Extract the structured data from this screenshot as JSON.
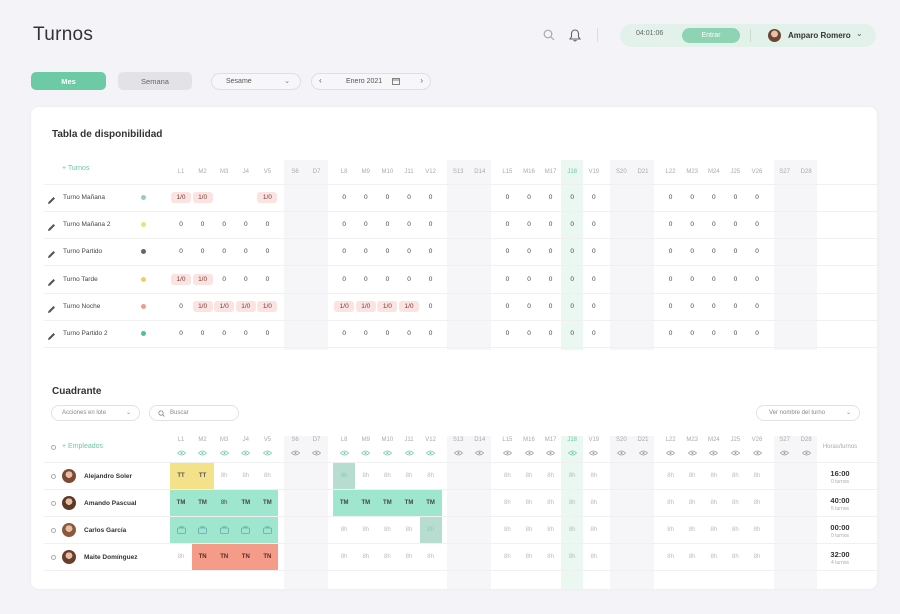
{
  "header": {
    "title": "Turnos",
    "timer": "04:01:06",
    "enter_label": "Entrar",
    "user_name": "Amparo Romero",
    "icons": [
      "search-icon",
      "bell-icon",
      "chevron-down-icon"
    ]
  },
  "toolbar": {
    "view_month": "Mes",
    "view_week": "Semana",
    "company": "Sesame",
    "month": "Enero 2021"
  },
  "availability": {
    "title": "Tabla de disponibilidad",
    "add_label": "+ Turnos",
    "days": [
      "L1",
      "M2",
      "M3",
      "J4",
      "V5",
      "S6",
      "D7",
      "L8",
      "M9",
      "M10",
      "J11",
      "V12",
      "S13",
      "D14",
      "L15",
      "M16",
      "M17",
      "J18",
      "V19",
      "S20",
      "D21",
      "L22",
      "M23",
      "M24",
      "J25",
      "V26",
      "S27",
      "D28"
    ],
    "rows": [
      {
        "name": "Turno Mañana",
        "dot": "#8ed3b4",
        "cells": [
          "1/0",
          "1/0",
          "",
          "",
          "1/0",
          "",
          "",
          "0",
          "0",
          "0",
          "0",
          "0",
          "",
          "",
          "0",
          "0",
          "0",
          "0",
          "0",
          "",
          "",
          "0",
          "0",
          "0",
          "0",
          "0",
          "",
          ""
        ]
      },
      {
        "name": "Turno Mañana 2",
        "dot": "#e9e27a",
        "cells": [
          "0",
          "0",
          "0",
          "0",
          "0",
          "",
          "",
          "0",
          "0",
          "0",
          "0",
          "0",
          "",
          "",
          "0",
          "0",
          "0",
          "0",
          "0",
          "",
          "",
          "0",
          "0",
          "0",
          "0",
          "0",
          "",
          ""
        ]
      },
      {
        "name": "Turno Partido",
        "dot": "#666666",
        "cells": [
          "0",
          "0",
          "0",
          "0",
          "0",
          "",
          "",
          "0",
          "0",
          "0",
          "0",
          "0",
          "",
          "",
          "0",
          "0",
          "0",
          "0",
          "0",
          "",
          "",
          "0",
          "0",
          "0",
          "0",
          "0",
          "",
          ""
        ]
      },
      {
        "name": "Turno Tarde",
        "dot": "#e9d35a",
        "cells": [
          "1/0",
          "1/0",
          "0",
          "0",
          "0",
          "",
          "",
          "0",
          "0",
          "0",
          "0",
          "0",
          "",
          "",
          "0",
          "0",
          "0",
          "0",
          "0",
          "",
          "",
          "0",
          "0",
          "0",
          "0",
          "0",
          "",
          ""
        ]
      },
      {
        "name": "Turno Noche",
        "dot": "#f19b8c",
        "cells": [
          "0",
          "1/0",
          "1/0",
          "1/0",
          "1/0",
          "",
          "",
          "1/0",
          "1/0",
          "1/0",
          "1/0",
          "0",
          "",
          "",
          "0",
          "0",
          "0",
          "0",
          "0",
          "",
          "",
          "0",
          "0",
          "0",
          "0",
          "0",
          "",
          ""
        ]
      },
      {
        "name": "Turno Partido 2",
        "dot": "#4cc29a",
        "cells": [
          "0",
          "0",
          "0",
          "0",
          "0",
          "",
          "",
          "0",
          "0",
          "0",
          "0",
          "0",
          "",
          "",
          "0",
          "0",
          "0",
          "0",
          "0",
          "",
          "",
          "0",
          "0",
          "0",
          "0",
          "0",
          "",
          ""
        ]
      }
    ]
  },
  "quadrant": {
    "title": "Cuadrante",
    "bulk_actions": "Acciones en lote",
    "search_placeholder": "Buscar",
    "view_shift_name": "Ver nombre del turno",
    "add_label": "+ Empleados",
    "hours_header": "Horas/turnos",
    "employees": [
      {
        "name": "Alejandro Soler",
        "hours": "16:00",
        "shifts": "0 turnos",
        "cells": [
          "TT",
          "TT",
          "8h",
          "8h",
          "8h",
          "",
          "",
          "8h",
          "8h",
          "8h",
          "8h",
          "8h",
          "",
          "",
          "8h",
          "8h",
          "8h",
          "8h",
          "8h",
          "",
          "",
          "8h",
          "8h",
          "8h",
          "8h",
          "8h",
          "",
          ""
        ],
        "kinds": [
          "tt",
          "tt",
          "",
          "",
          "",
          "",
          "",
          "sel",
          "",
          "",
          "",
          "",
          "",
          "",
          "",
          "",
          "",
          "",
          "",
          "",
          "",
          "",
          "",
          "",
          "",
          "",
          "",
          ""
        ]
      },
      {
        "name": "Amando Pascual",
        "hours": "40:00",
        "shifts": "5 turnos",
        "cells": [
          "TM",
          "TM",
          "8h",
          "TM",
          "TM",
          "",
          "",
          "TM",
          "TM",
          "TM",
          "TM",
          "TM",
          "",
          "",
          "8h",
          "8h",
          "8h",
          "8h",
          "8h",
          "",
          "",
          "8h",
          "8h",
          "8h",
          "8h",
          "8h",
          "",
          ""
        ],
        "kinds": [
          "tm",
          "tm",
          "tm",
          "tm",
          "tm",
          "",
          "",
          "tm",
          "tm",
          "tm",
          "tm",
          "tm",
          "",
          "",
          "",
          "",
          "",
          "",
          "",
          "",
          "",
          "",
          "",
          "",
          "",
          "",
          "",
          ""
        ]
      },
      {
        "name": "Carlos García",
        "hours": "00:00",
        "shifts": "0 turnos",
        "cells": [
          "",
          "",
          "",
          "",
          "",
          "",
          "",
          "8h",
          "8h",
          "8h",
          "8h",
          "8h",
          "",
          "",
          "8h",
          "8h",
          "8h",
          "8h",
          "8h",
          "",
          "",
          "8h",
          "8h",
          "8h",
          "8h",
          "8h",
          "",
          ""
        ],
        "kinds": [
          "tm",
          "tm",
          "tm",
          "tm",
          "tm",
          "",
          "",
          "",
          "",
          "",
          "",
          "sel",
          "",
          "",
          "",
          "",
          "",
          "",
          "",
          "",
          "",
          "",
          "",
          "",
          "",
          "",
          "",
          ""
        ]
      },
      {
        "name": "Maite Domínguez",
        "hours": "32:00",
        "shifts": "4 turnos",
        "cells": [
          "8h",
          "TN",
          "TN",
          "TN",
          "TN",
          "",
          "",
          "8h",
          "8h",
          "8h",
          "8h",
          "8h",
          "",
          "",
          "8h",
          "8h",
          "8h",
          "8h",
          "8h",
          "",
          "",
          "8h",
          "8h",
          "8h",
          "8h",
          "8h",
          "",
          ""
        ],
        "kinds": [
          "",
          "tn",
          "tn",
          "tn",
          "tn",
          "",
          "",
          "",
          "",
          "",
          "",
          "",
          "",
          "",
          "",
          "",
          "",
          "",
          "",
          "",
          "",
          "",
          "",
          "",
          "",
          "",
          "",
          ""
        ]
      }
    ]
  },
  "colors": {
    "accent": "#6ccaa4",
    "morning": "#9fe6cf",
    "afternoon": "#f3e28a",
    "night": "#f49b8a",
    "availability": "#fbe3e1"
  }
}
